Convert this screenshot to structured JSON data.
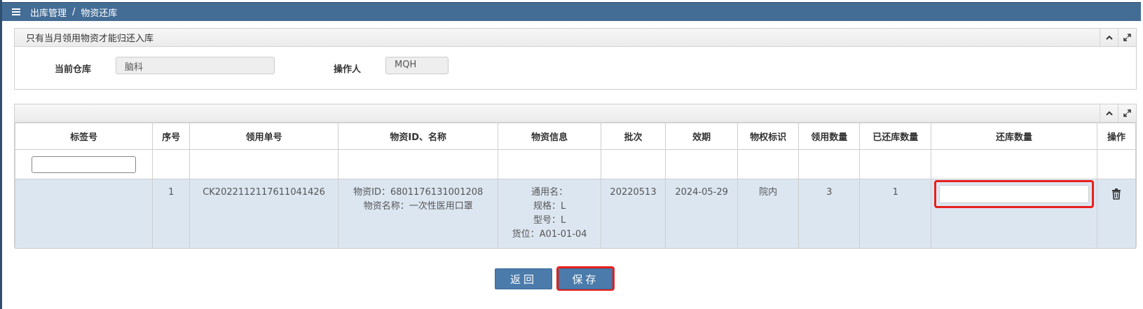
{
  "breadcrumb": {
    "parent": "出库管理",
    "separator": "/",
    "current": "物资还库"
  },
  "info_panel": {
    "title": "只有当月领用物资才能归还入库",
    "warehouse_label": "当前仓库",
    "warehouse_value": "脑科",
    "operator_label": "操作人",
    "operator_value": "MQH"
  },
  "table": {
    "headers": [
      "标签号",
      "序号",
      "领用单号",
      "物资ID、名称",
      "物资信息",
      "批次",
      "效期",
      "物权标识",
      "领用数量",
      "已还库数量",
      "还库数量",
      "操作"
    ],
    "rows": [
      {
        "tag": "",
        "index": "1",
        "order_no": "CK2022112117611041426",
        "material_id": "物资ID：6801176131001208",
        "material_name": "物资名称：一次性医用口罩",
        "info_common": "通用名：",
        "info_spec": "规格：L",
        "info_model": "型号：L",
        "info_location": "货位：A01-01-04",
        "batch": "20220513",
        "expiry": "2024-05-29",
        "ownership": "院内",
        "issued_qty": "3",
        "returned_qty": "1",
        "return_qty_value": ""
      }
    ]
  },
  "buttons": {
    "back": "返回",
    "save": "保存"
  },
  "colors": {
    "topbar": "#446d96",
    "button": "#4a7bab",
    "row_highlight": "#dce6f1",
    "annotation": "#e8201c"
  }
}
